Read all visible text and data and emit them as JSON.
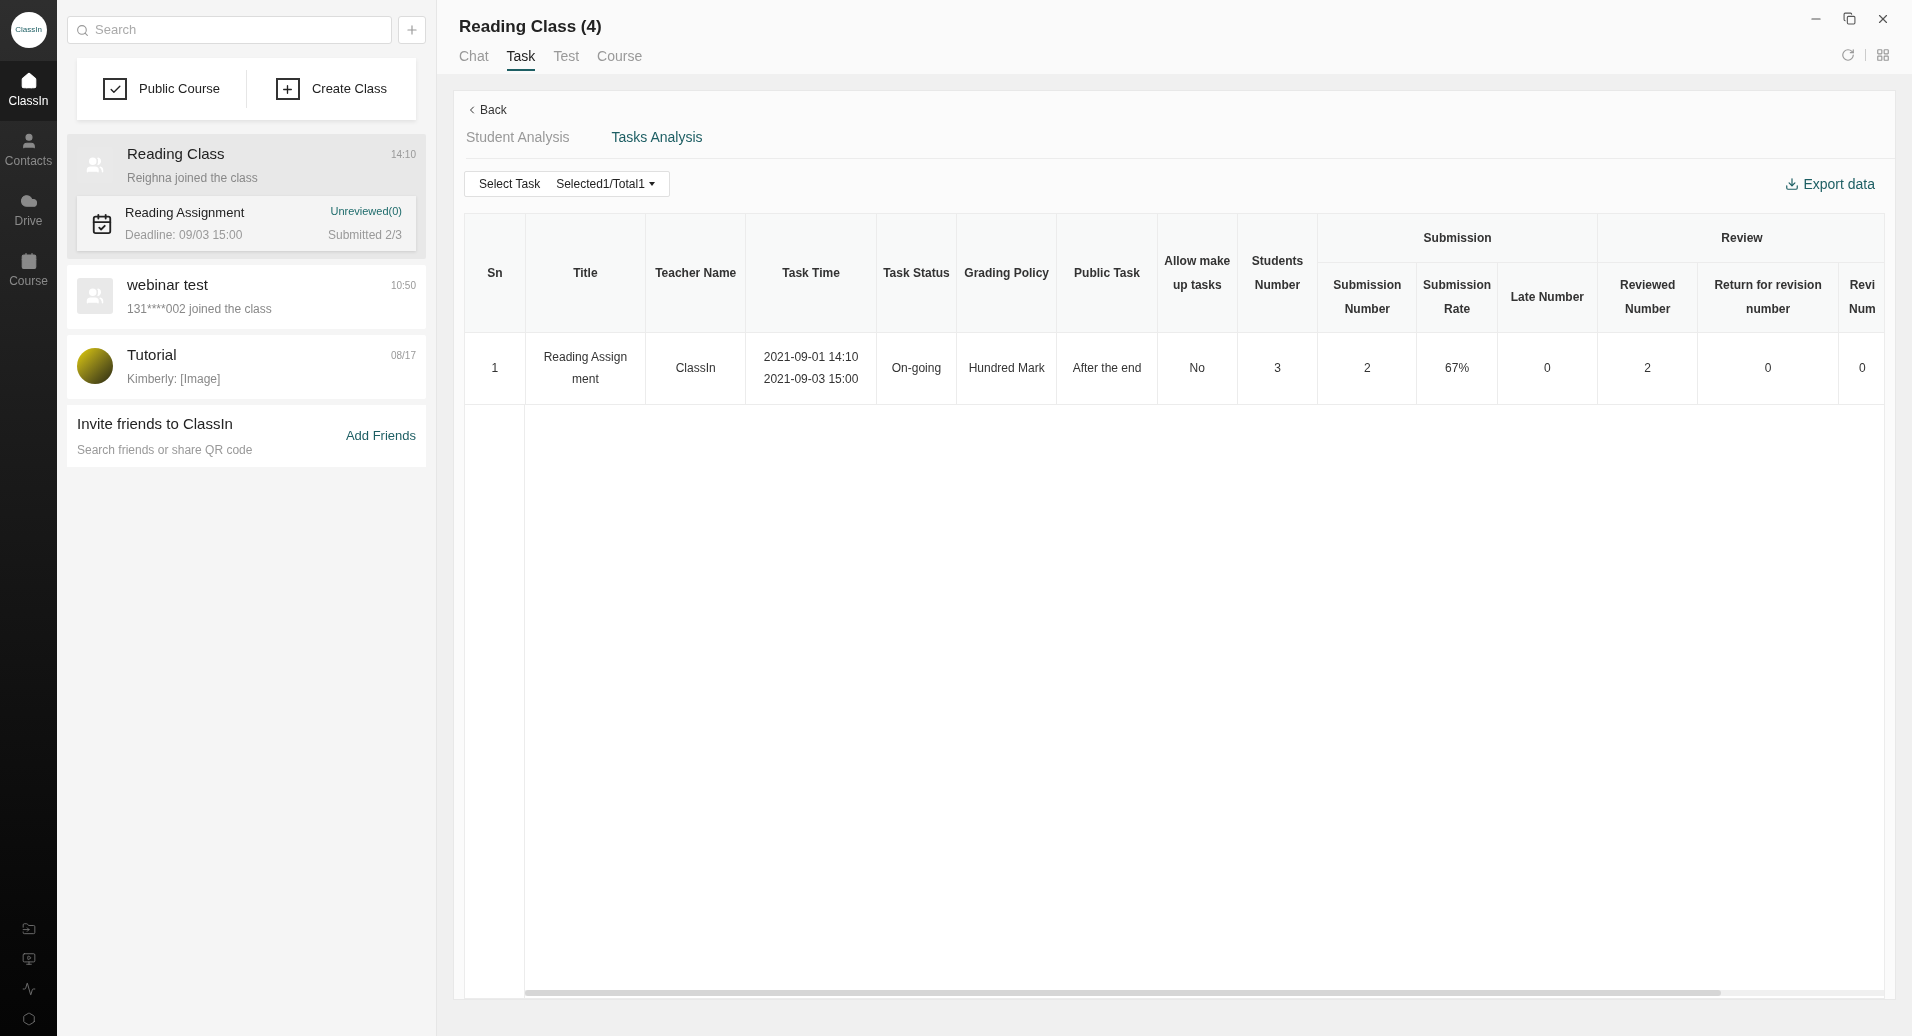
{
  "rail": {
    "logo": "ClassIn",
    "items": [
      {
        "label": "ClassIn",
        "kind": "home",
        "selected": true
      },
      {
        "label": "Contacts",
        "kind": "person",
        "selected": false
      },
      {
        "label": "Drive",
        "kind": "cloud",
        "selected": false
      },
      {
        "label": "Course",
        "kind": "calendar",
        "selected": false
      }
    ]
  },
  "list": {
    "search": {
      "placeholder": "Search"
    },
    "actions": [
      {
        "label": "Public Course",
        "kind": "check"
      },
      {
        "label": "Create Class",
        "kind": "plus"
      }
    ],
    "conversations": [
      {
        "title": "Reading Class",
        "time": "14:10",
        "subtitle": "Reighna joined the class",
        "kind": "group",
        "selected": true,
        "task": {
          "title": "Reading Assignment",
          "deadline": "Deadline: 09/03 15:00",
          "status": "Unreviewed(0)",
          "submitted": "Submitted 2/3"
        }
      },
      {
        "title": "webinar test",
        "time": "10:50",
        "subtitle": "131****002 joined the class",
        "kind": "group",
        "selected": false
      },
      {
        "title": "Tutorial",
        "time": "08/17",
        "subtitle": "Kimberly: [Image]",
        "kind": "photo",
        "selected": false
      }
    ],
    "invite": {
      "title": "Invite friends to ClassIn",
      "subtitle": "Search friends or share QR code",
      "action": "Add Friends"
    }
  },
  "header": {
    "title": "Reading Class (4)",
    "tabs": [
      {
        "label": "Chat",
        "selected": false
      },
      {
        "label": "Task",
        "selected": true
      },
      {
        "label": "Test",
        "selected": false
      },
      {
        "label": "Course",
        "selected": false
      }
    ]
  },
  "panel": {
    "back": "Back",
    "subtabs": [
      {
        "label": "Student Analysis",
        "selected": false
      },
      {
        "label": "Tasks Analysis",
        "selected": true
      }
    ],
    "select_task": {
      "label": "Select Task",
      "value": "Selected1/Total1"
    },
    "export": "Export data",
    "table": {
      "header_rows": [
        [
          {
            "label": "Sn",
            "rowspan": 2
          },
          {
            "label": "Title",
            "rowspan": 2
          },
          {
            "label": "Teacher Name",
            "rowspan": 2
          },
          {
            "label": "Task Time",
            "rowspan": 2
          },
          {
            "label": "Task Status",
            "rowspan": 2
          },
          {
            "label": "Grading Policy",
            "rowspan": 2
          },
          {
            "label": "Public Task",
            "rowspan": 2
          },
          {
            "label": "Allow make up tasks",
            "rowspan": 2
          },
          {
            "label": "Students Number",
            "rowspan": 2
          },
          {
            "label": "Submission",
            "colspan": 3
          },
          {
            "label": "Review",
            "colspan": 3
          }
        ],
        [
          {
            "label": "Submission Number"
          },
          {
            "label": "Submission Rate"
          },
          {
            "label": "Late Number"
          },
          {
            "label": "Reviewed Number"
          },
          {
            "label": "Return for revision number"
          },
          {
            "label": "Revi Num"
          }
        ]
      ],
      "rows": [
        [
          [
            "1"
          ],
          [
            "Reading Assignment"
          ],
          [
            "ClassIn"
          ],
          [
            "2021-09-01 14:10",
            "2021-09-03 15:00"
          ],
          [
            "On-going"
          ],
          [
            "Hundred Mark"
          ],
          [
            "After the end"
          ],
          [
            "No"
          ],
          [
            "3"
          ],
          [
            "2"
          ],
          [
            "67%"
          ],
          [
            "0"
          ],
          [
            "2"
          ],
          [
            "0"
          ],
          [
            "0"
          ]
        ]
      ]
    }
  }
}
